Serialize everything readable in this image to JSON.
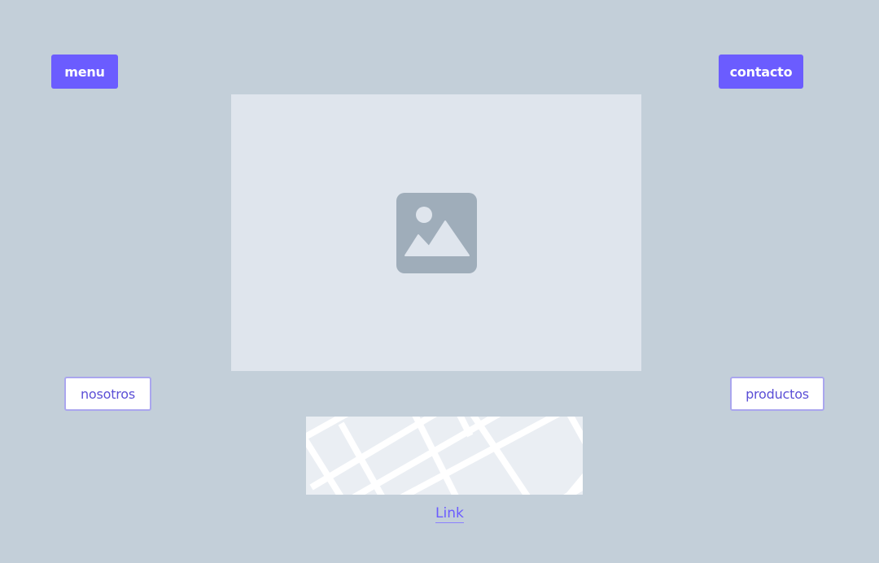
{
  "buttons": {
    "menu": "menu",
    "contacto": "contacto",
    "nosotros": "nosotros",
    "productos": "productos"
  },
  "link": {
    "label": "Link"
  },
  "icons": {
    "image_placeholder": "image-icon",
    "map_placeholder": "map-icon"
  },
  "colors": {
    "background": "#c3cfd9",
    "accent": "#6b5cff",
    "placeholder": "#dfe5ed",
    "icon": "#9fadba"
  }
}
